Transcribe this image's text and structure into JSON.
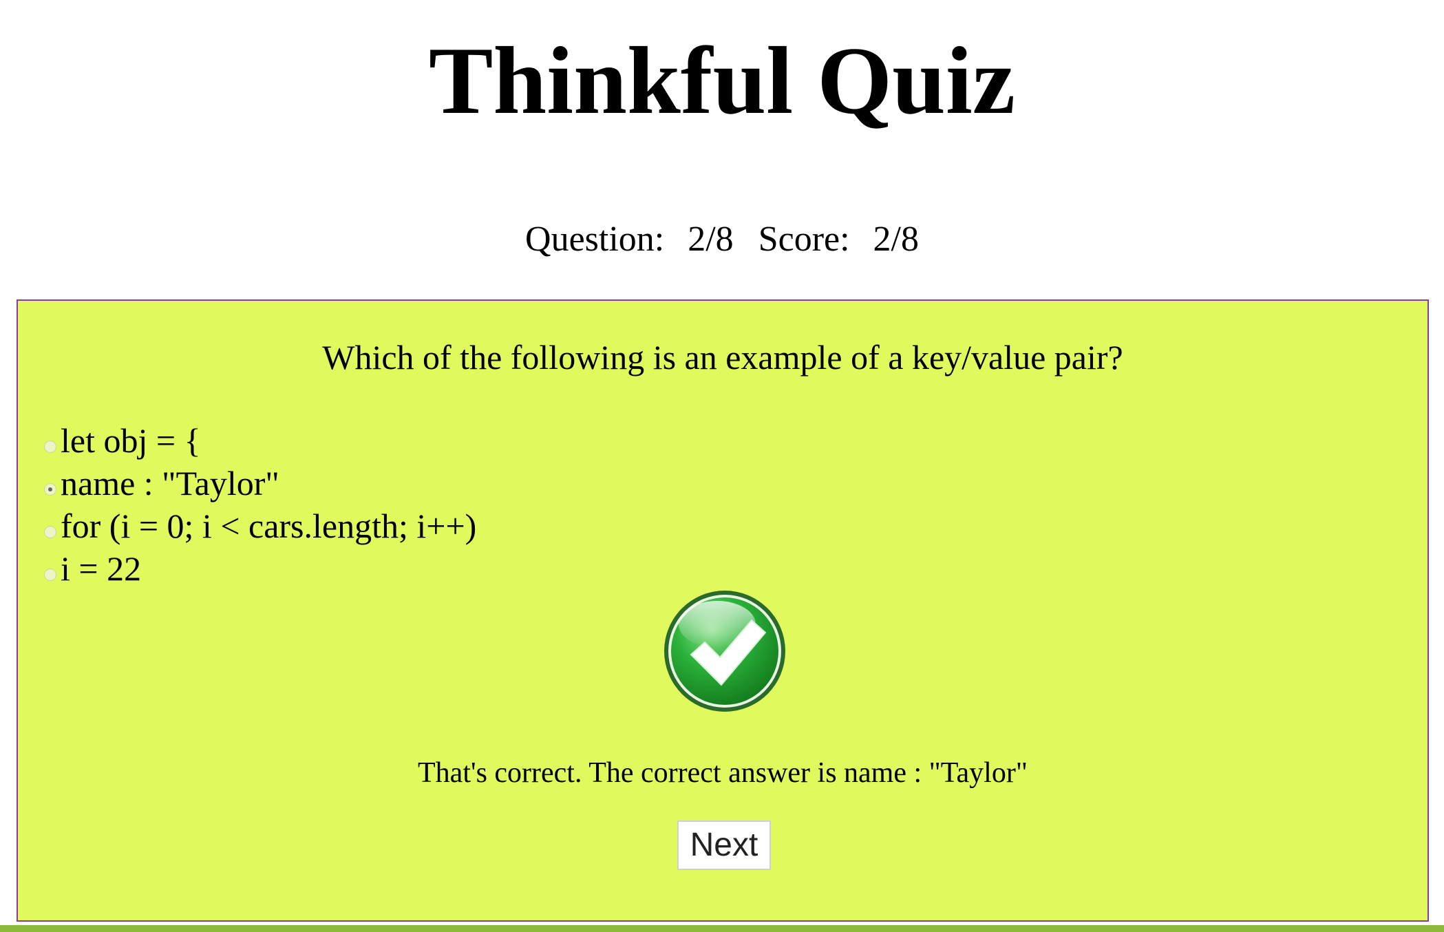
{
  "app": {
    "title": "Thinkful Quiz"
  },
  "status": {
    "question_label": "Question:",
    "question_value": "2/8",
    "score_label": "Score:",
    "score_value": "2/8"
  },
  "quiz": {
    "question": "Which of the following is an example of a key/value pair?",
    "answers": [
      {
        "label": "let obj = {",
        "selected": false
      },
      {
        "label": "name : \"Taylor\"",
        "selected": true
      },
      {
        "label": "for (i = 0; i < cars.length; i++)",
        "selected": false
      },
      {
        "label": "i = 22",
        "selected": false
      }
    ],
    "result_icon": "check-icon",
    "feedback": "That's correct. The correct answer is name : \"Taylor\"",
    "next_label": "Next"
  },
  "colors": {
    "panel_bg": "#e0fa5e",
    "panel_border": "#8a3aa0",
    "bottom_bar": "#8dba3a",
    "check_green": "#1f9a2a"
  }
}
